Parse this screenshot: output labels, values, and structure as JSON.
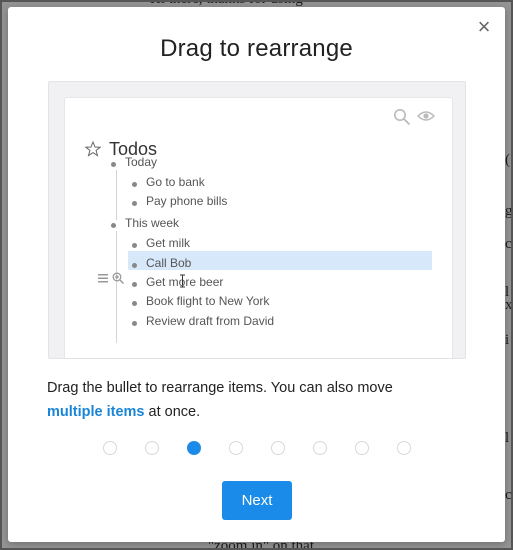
{
  "background": {
    "top_text": "Hi there, thanks for using",
    "bottom_text": "\"zoom in\" on that",
    "right_glyphs": [
      "(",
      "g",
      "c",
      "l",
      "x",
      "i",
      "l",
      "c"
    ]
  },
  "modal": {
    "title": "Drag to rearrange",
    "close_label": "×",
    "illustration": {
      "doc_title": "Todos",
      "nodes": {
        "today": "Today",
        "bank": "Go to bank",
        "phone": "Pay phone bills",
        "week": "This week",
        "milk": "Get milk",
        "bob": "Call Bob",
        "beer": "Get more beer",
        "flight": "Book flight to New York",
        "draft": "Review draft from David"
      }
    },
    "description": {
      "part1": "Drag the bullet to rearrange items. You can also move",
      "link": "multiple items",
      "part2": " at once."
    },
    "pagination": {
      "total": 8,
      "active_index": 2
    },
    "next_label": "Next"
  },
  "colors": {
    "accent": "#1a8be8",
    "link": "#1a85d6",
    "highlight": "#d7e8fb"
  }
}
